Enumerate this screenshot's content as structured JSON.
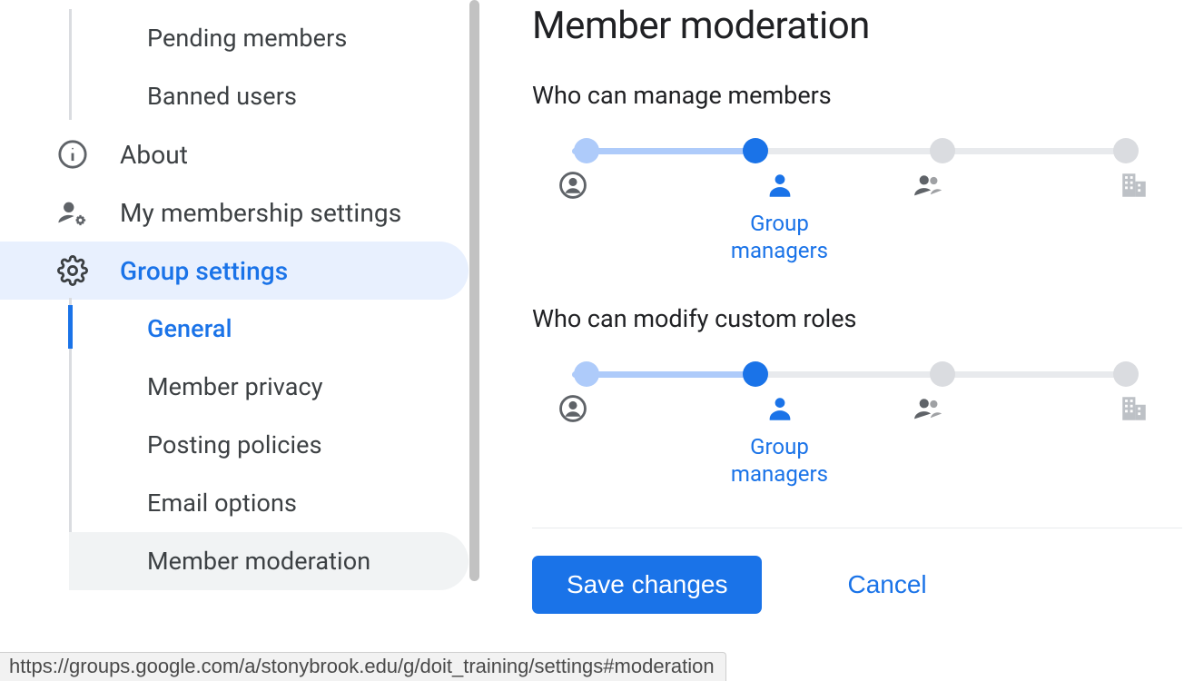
{
  "sidebar": {
    "pending_members": "Pending members",
    "banned_users": "Banned users",
    "about": "About",
    "membership_settings": "My membership settings",
    "group_settings": "Group settings",
    "sub": {
      "general": "General",
      "member_privacy": "Member privacy",
      "posting_policies": "Posting policies",
      "email_options": "Email options",
      "member_moderation": "Member moderation"
    }
  },
  "main": {
    "title": "Member moderation",
    "manage_members_label": "Who can manage members",
    "modify_roles_label": "Who can modify custom roles",
    "tick_label": "Group\nmanagers",
    "save_label": "Save changes",
    "cancel_label": "Cancel"
  },
  "status": {
    "url": "https://groups.google.com/a/stonybrook.edu/g/doit_training/settings#moderation"
  }
}
